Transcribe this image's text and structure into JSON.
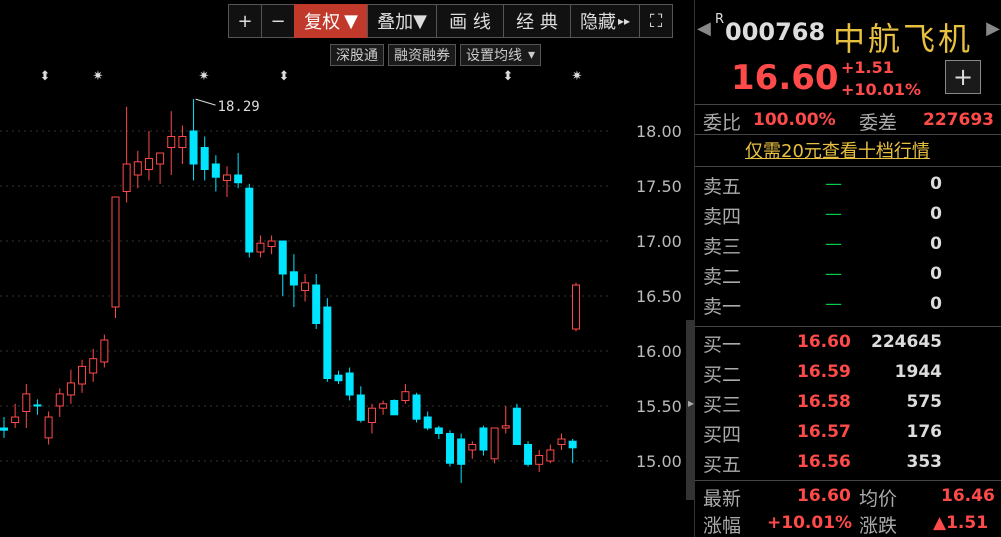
{
  "toolbar": {
    "plus": "+",
    "minus": "−",
    "fuquan": "复权",
    "fuquan_arrow": "▼",
    "diejia": "叠加",
    "diejia_arrow": "▼",
    "huaxian": "画 线",
    "jingdian": "经 典",
    "yincang": "隐藏",
    "yincang_arrow": "▸▸",
    "fullscreen": "⛶"
  },
  "subbar": {
    "shengutong": "深股通",
    "rongzi": "融资融券",
    "set_ma": "设置均线",
    "set_ma_arrow": "▾"
  },
  "colors": {
    "up": "#ff4a4a",
    "down": "#00e5ff",
    "accent": "#e8c040",
    "green": "#00cc44"
  },
  "chart_data": {
    "type": "candlestick",
    "y_ticks": [
      "18.00",
      "17.50",
      "17.00",
      "16.50",
      "16.00",
      "15.50",
      "15.00"
    ],
    "ylim": [
      14.65,
      18.6
    ],
    "grid": true,
    "high_annotation": "18.29",
    "markers": [
      "⬍",
      "✷",
      "✷",
      "⬍",
      "⬍",
      "✷"
    ],
    "candles": [
      {
        "o": 15.3,
        "h": 15.4,
        "l": 15.21,
        "c": 15.28
      },
      {
        "o": 15.35,
        "h": 15.52,
        "l": 15.3,
        "c": 15.4
      },
      {
        "o": 15.45,
        "h": 15.7,
        "l": 15.3,
        "c": 15.61
      },
      {
        "o": 15.51,
        "h": 15.56,
        "l": 15.42,
        "c": 15.5
      },
      {
        "o": 15.21,
        "h": 15.45,
        "l": 15.15,
        "c": 15.4
      },
      {
        "o": 15.5,
        "h": 15.66,
        "l": 15.4,
        "c": 15.61
      },
      {
        "o": 15.6,
        "h": 15.83,
        "l": 15.52,
        "c": 15.71
      },
      {
        "o": 15.7,
        "h": 15.92,
        "l": 15.62,
        "c": 15.86
      },
      {
        "o": 15.8,
        "h": 16.02,
        "l": 15.72,
        "c": 15.93
      },
      {
        "o": 15.9,
        "h": 16.15,
        "l": 15.85,
        "c": 16.1
      },
      {
        "o": 16.4,
        "h": 17.4,
        "l": 16.3,
        "c": 17.4
      },
      {
        "o": 17.45,
        "h": 18.22,
        "l": 17.35,
        "c": 17.7
      },
      {
        "o": 17.6,
        "h": 17.82,
        "l": 17.48,
        "c": 17.72
      },
      {
        "o": 17.65,
        "h": 18.0,
        "l": 17.55,
        "c": 17.75
      },
      {
        "o": 17.7,
        "h": 17.8,
        "l": 17.52,
        "c": 17.8
      },
      {
        "o": 17.85,
        "h": 18.18,
        "l": 17.6,
        "c": 17.95
      },
      {
        "o": 17.85,
        "h": 18.05,
        "l": 17.7,
        "c": 17.95
      },
      {
        "o": 18.0,
        "h": 18.29,
        "l": 17.55,
        "c": 17.7
      },
      {
        "o": 17.85,
        "h": 17.95,
        "l": 17.55,
        "c": 17.65
      },
      {
        "o": 17.7,
        "h": 17.78,
        "l": 17.45,
        "c": 17.58
      },
      {
        "o": 17.55,
        "h": 17.68,
        "l": 17.4,
        "c": 17.6
      },
      {
        "o": 17.6,
        "h": 17.8,
        "l": 17.48,
        "c": 17.53
      },
      {
        "o": 17.48,
        "h": 17.52,
        "l": 16.85,
        "c": 16.9
      },
      {
        "o": 16.9,
        "h": 17.05,
        "l": 16.85,
        "c": 16.98
      },
      {
        "o": 16.95,
        "h": 17.05,
        "l": 16.88,
        "c": 17.0
      },
      {
        "o": 17.0,
        "h": 17.0,
        "l": 16.5,
        "c": 16.7
      },
      {
        "o": 16.72,
        "h": 16.88,
        "l": 16.4,
        "c": 16.6
      },
      {
        "o": 16.55,
        "h": 16.7,
        "l": 16.45,
        "c": 16.62
      },
      {
        "o": 16.6,
        "h": 16.7,
        "l": 16.2,
        "c": 16.25
      },
      {
        "o": 16.4,
        "h": 16.48,
        "l": 15.72,
        "c": 15.75
      },
      {
        "o": 15.78,
        "h": 15.82,
        "l": 15.7,
        "c": 15.73
      },
      {
        "o": 15.8,
        "h": 15.85,
        "l": 15.55,
        "c": 15.6
      },
      {
        "o": 15.6,
        "h": 15.68,
        "l": 15.35,
        "c": 15.37
      },
      {
        "o": 15.35,
        "h": 15.52,
        "l": 15.25,
        "c": 15.48
      },
      {
        "o": 15.48,
        "h": 15.55,
        "l": 15.42,
        "c": 15.52
      },
      {
        "o": 15.55,
        "h": 15.56,
        "l": 15.42,
        "c": 15.42
      },
      {
        "o": 15.55,
        "h": 15.7,
        "l": 15.52,
        "c": 15.63
      },
      {
        "o": 15.6,
        "h": 15.62,
        "l": 15.35,
        "c": 15.38
      },
      {
        "o": 15.4,
        "h": 15.45,
        "l": 15.28,
        "c": 15.3
      },
      {
        "o": 15.3,
        "h": 15.32,
        "l": 15.2,
        "c": 15.25
      },
      {
        "o": 15.25,
        "h": 15.28,
        "l": 14.95,
        "c": 14.98
      },
      {
        "o": 15.2,
        "h": 15.25,
        "l": 14.8,
        "c": 14.97
      },
      {
        "o": 15.1,
        "h": 15.18,
        "l": 15.02,
        "c": 15.15
      },
      {
        "o": 15.3,
        "h": 15.32,
        "l": 15.05,
        "c": 15.1
      },
      {
        "o": 15.02,
        "h": 15.3,
        "l": 14.98,
        "c": 15.3
      },
      {
        "o": 15.3,
        "h": 15.5,
        "l": 15.25,
        "c": 15.32
      },
      {
        "o": 15.48,
        "h": 15.52,
        "l": 15.15,
        "c": 15.15
      },
      {
        "o": 15.15,
        "h": 15.18,
        "l": 14.95,
        "c": 14.97
      },
      {
        "o": 14.97,
        "h": 15.1,
        "l": 14.9,
        "c": 15.05
      },
      {
        "o": 15.0,
        "h": 15.15,
        "l": 14.98,
        "c": 15.1
      },
      {
        "o": 15.15,
        "h": 15.25,
        "l": 15.1,
        "c": 15.2
      },
      {
        "o": 15.18,
        "h": 15.2,
        "l": 14.98,
        "c": 15.12
      },
      {
        "o": 16.2,
        "h": 16.62,
        "l": 16.18,
        "c": 16.6
      }
    ]
  },
  "quote": {
    "r_mark": "R",
    "code": "000768",
    "name": "中航飞机",
    "price": "16.60",
    "change": "+1.51",
    "change_pct": "+10.01%",
    "add_btn": "+",
    "nav_left": "◀",
    "nav_right": "▶",
    "weibi_label": "委比",
    "weibi_value": "100.00%",
    "weicha_label": "委差",
    "weicha_value": "227693",
    "promo": "仅需20元查看十档行情",
    "sell": [
      {
        "label": "卖五",
        "price": "—",
        "vol": "0"
      },
      {
        "label": "卖四",
        "price": "—",
        "vol": "0"
      },
      {
        "label": "卖三",
        "price": "—",
        "vol": "0"
      },
      {
        "label": "卖二",
        "price": "—",
        "vol": "0"
      },
      {
        "label": "卖一",
        "price": "—",
        "vol": "0"
      }
    ],
    "buy": [
      {
        "label": "买一",
        "price": "16.60",
        "vol": "224645"
      },
      {
        "label": "买二",
        "price": "16.59",
        "vol": "1944"
      },
      {
        "label": "买三",
        "price": "16.58",
        "vol": "575"
      },
      {
        "label": "买四",
        "price": "16.57",
        "vol": "176"
      },
      {
        "label": "买五",
        "price": "16.56",
        "vol": "353"
      }
    ],
    "latest_label": "最新",
    "latest_value": "16.60",
    "avg_label": "均价",
    "avg_value": "16.46",
    "zhangfu_label": "涨幅",
    "zhangfu_value": "+10.01%",
    "zhangdie_label": "涨跌",
    "zhangdie_value": "▲1.51"
  }
}
